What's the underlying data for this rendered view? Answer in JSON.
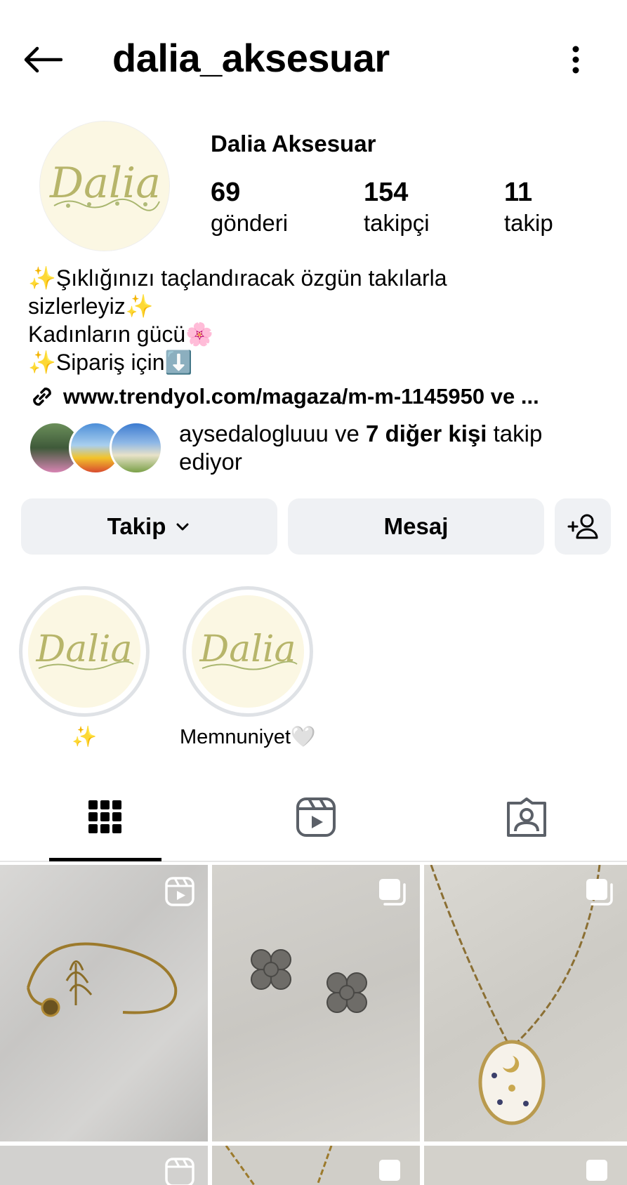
{
  "header": {
    "username": "dalia_aksesuar"
  },
  "profile": {
    "display_name": "Dalia Aksesuar",
    "avatar_text": "Dalia",
    "stats": [
      {
        "value": "69",
        "label": "gönderi"
      },
      {
        "value": "154",
        "label": "takipçi"
      },
      {
        "value": "11",
        "label": "takip"
      }
    ],
    "bio_lines": [
      "✨Şıklığınızı taçlandıracak özgün takılarla",
      "sizlerleyiz✨",
      "Kadınların gücü🌸",
      "✨Sipariş için⬇️"
    ],
    "link": "www.trendyol.com/magaza/m-m-1145950 ve ..."
  },
  "followed_by": {
    "name": "aysedalogluuu",
    "connector": " ve ",
    "others": "7 diğer kişi",
    "suffix": " takip ediyor"
  },
  "actions": {
    "follow_label": "Takip",
    "message_label": "Mesaj"
  },
  "highlights": [
    {
      "label": "✨",
      "cover_text": "Dalia"
    },
    {
      "label": "Memnuniyet🤍",
      "cover_text": "Dalia"
    }
  ],
  "tabs": {
    "active": "posts",
    "items": [
      "grid-icon",
      "reels-icon",
      "tagged-icon"
    ]
  },
  "posts": [
    {
      "type": "reel",
      "subject": "bracelet"
    },
    {
      "type": "carousel",
      "subject": "earrings"
    },
    {
      "type": "carousel",
      "subject": "necklace"
    },
    {
      "type": "reel",
      "subject": "partial"
    },
    {
      "type": "carousel",
      "subject": "partial"
    },
    {
      "type": "carousel",
      "subject": "partial"
    }
  ],
  "colors": {
    "button_bg": "#eff1f4",
    "logo_bg": "#fbf7e3",
    "logo_text": "#b7b56a",
    "ring": "#dfe2e6"
  }
}
